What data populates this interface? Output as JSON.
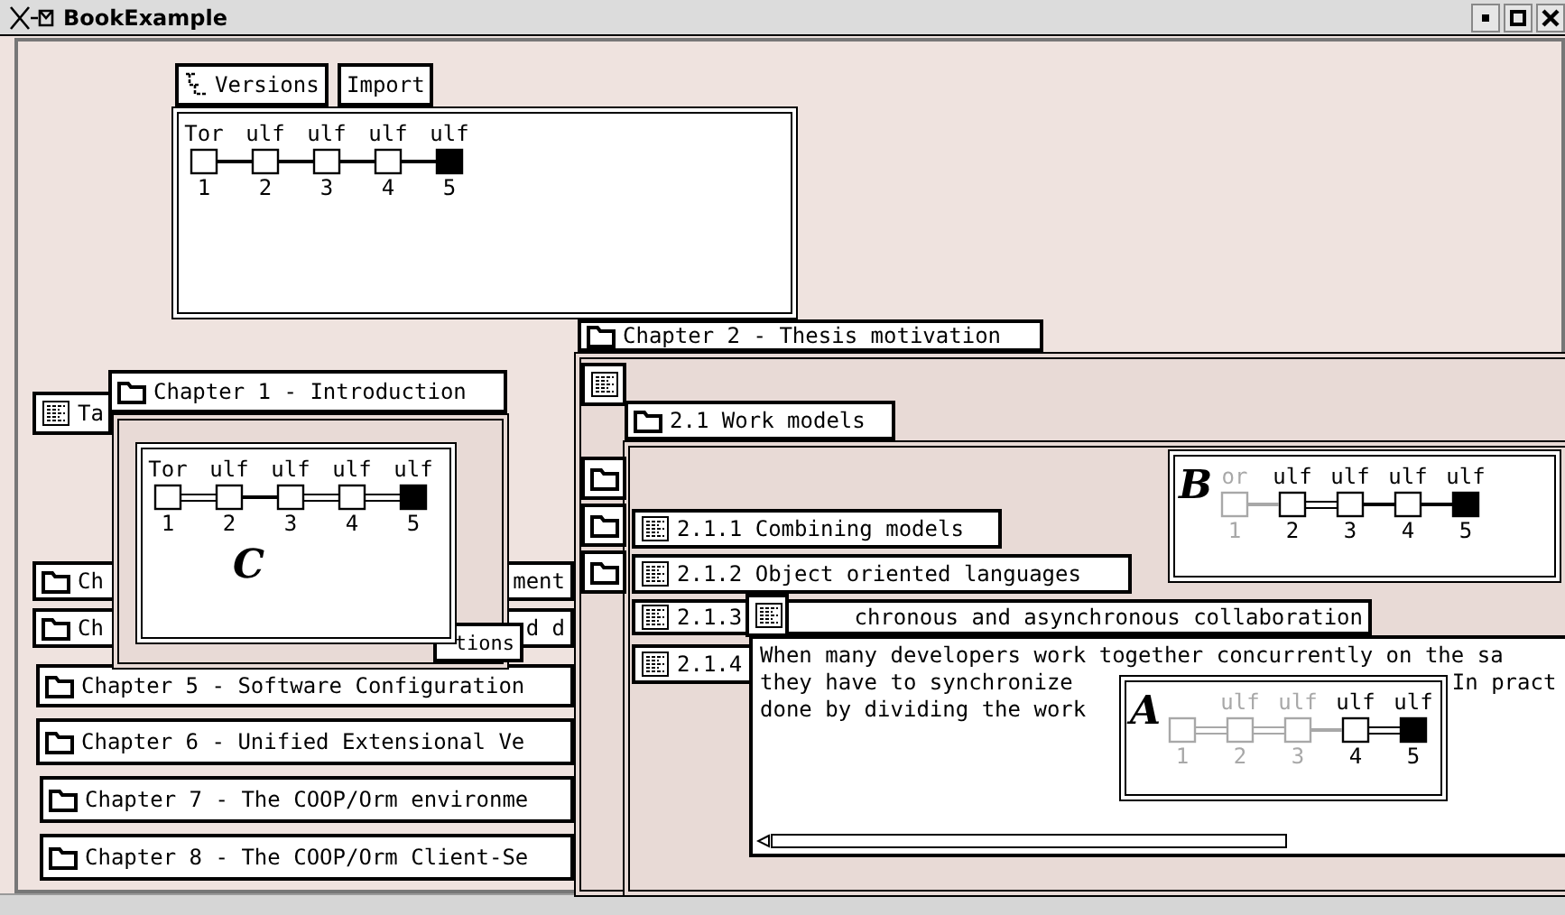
{
  "window": {
    "title": "BookExample"
  },
  "version_panel": {
    "tabs": [
      {
        "label": "Versions"
      },
      {
        "label": "Import"
      }
    ],
    "graph": {
      "nodes": [
        {
          "author": "Tor",
          "number": "1",
          "current": false,
          "dimmed": false
        },
        {
          "author": "ulf",
          "number": "2",
          "current": false,
          "dimmed": false
        },
        {
          "author": "ulf",
          "number": "3",
          "current": false,
          "dimmed": false
        },
        {
          "author": "ulf",
          "number": "4",
          "current": false,
          "dimmed": false
        },
        {
          "author": "ulf",
          "number": "5",
          "current": true,
          "dimmed": false
        }
      ],
      "links": [
        {
          "double": false
        },
        {
          "double": false
        },
        {
          "double": false
        },
        {
          "double": false
        }
      ]
    }
  },
  "left_pane": {
    "tag_tile": {
      "kind": "document",
      "text": "Ta"
    },
    "chapter_1": {
      "title": "Chapter 1 - Introduction",
      "hidden_item_fragment": "tions",
      "graph": {
        "label": "C",
        "nodes": [
          {
            "author": "Tor",
            "number": "1",
            "current": false,
            "dimmed": false
          },
          {
            "author": "ulf",
            "number": "2",
            "current": false,
            "dimmed": false
          },
          {
            "author": "ulf",
            "number": "3",
            "current": false,
            "dimmed": false
          },
          {
            "author": "ulf",
            "number": "4",
            "current": false,
            "dimmed": false
          },
          {
            "author": "ulf",
            "number": "5",
            "current": true,
            "dimmed": false
          }
        ],
        "links": [
          {
            "double": true
          },
          {
            "double": false
          },
          {
            "double": true
          },
          {
            "double": true
          }
        ]
      }
    },
    "chapters": [
      {
        "kind": "folder",
        "parts": [
          "Ch",
          "ment"
        ]
      },
      {
        "kind": "folder",
        "parts": [
          "Ch",
          "d d"
        ]
      },
      {
        "kind": "folder",
        "parts": [
          "Chapter 5 - Software Configuration"
        ]
      },
      {
        "kind": "folder",
        "parts": [
          "Chapter 6 - Unified Extensional Ve"
        ]
      },
      {
        "kind": "folder",
        "parts": [
          "Chapter 7 - The COOP/Orm environme"
        ]
      },
      {
        "kind": "folder",
        "parts": [
          "Chapter 8 - The COOP/Orm Client-Se"
        ]
      }
    ]
  },
  "right_pane": {
    "chapter_2": {
      "title": "Chapter 2 - Thesis motivation"
    },
    "section": {
      "title": "2.1 Work models",
      "subsections": [
        {
          "kind": "document",
          "parts": [
            "2.1.1 Combining models"
          ]
        },
        {
          "kind": "document",
          "parts": [
            "2.1.2 Object oriented languages"
          ]
        },
        {
          "kind": "document",
          "parts": [
            "2.1.3",
            "chronous and asynchronous collaboration"
          ]
        },
        {
          "kind": "document",
          "parts": [
            "2.1.4"
          ]
        }
      ],
      "text_lines": [
        [
          "When many developers work together concurrently on the sa"
        ],
        [
          "they have to synchronize",
          "In pract"
        ],
        [
          "done by dividing the work"
        ]
      ],
      "graph_b": {
        "label": "B",
        "nodes": [
          {
            "author": "or",
            "number": "1",
            "current": false,
            "dimmed": true
          },
          {
            "author": "ulf",
            "number": "2",
            "current": false,
            "dimmed": false
          },
          {
            "author": "ulf",
            "number": "3",
            "current": false,
            "dimmed": false
          },
          {
            "author": "ulf",
            "number": "4",
            "current": false,
            "dimmed": false
          },
          {
            "author": "ulf",
            "number": "5",
            "current": true,
            "dimmed": false
          }
        ],
        "links": [
          {
            "double": false
          },
          {
            "double": true
          },
          {
            "double": false
          },
          {
            "double": false
          }
        ]
      },
      "graph_a": {
        "label": "A",
        "nodes": [
          {
            "number": "1",
            "current": false,
            "dimmed": true
          },
          {
            "author": "ulf",
            "number": "2",
            "current": false,
            "dimmed": true
          },
          {
            "author": "ulf",
            "number": "3",
            "current": false,
            "dimmed": true
          },
          {
            "author": "ulf",
            "number": "4",
            "current": false,
            "dimmed": false
          },
          {
            "author": "ulf",
            "number": "5",
            "current": true,
            "dimmed": false
          }
        ],
        "links": [
          {
            "double": true
          },
          {
            "double": true
          },
          {
            "double": false
          },
          {
            "double": true
          }
        ]
      }
    }
  }
}
